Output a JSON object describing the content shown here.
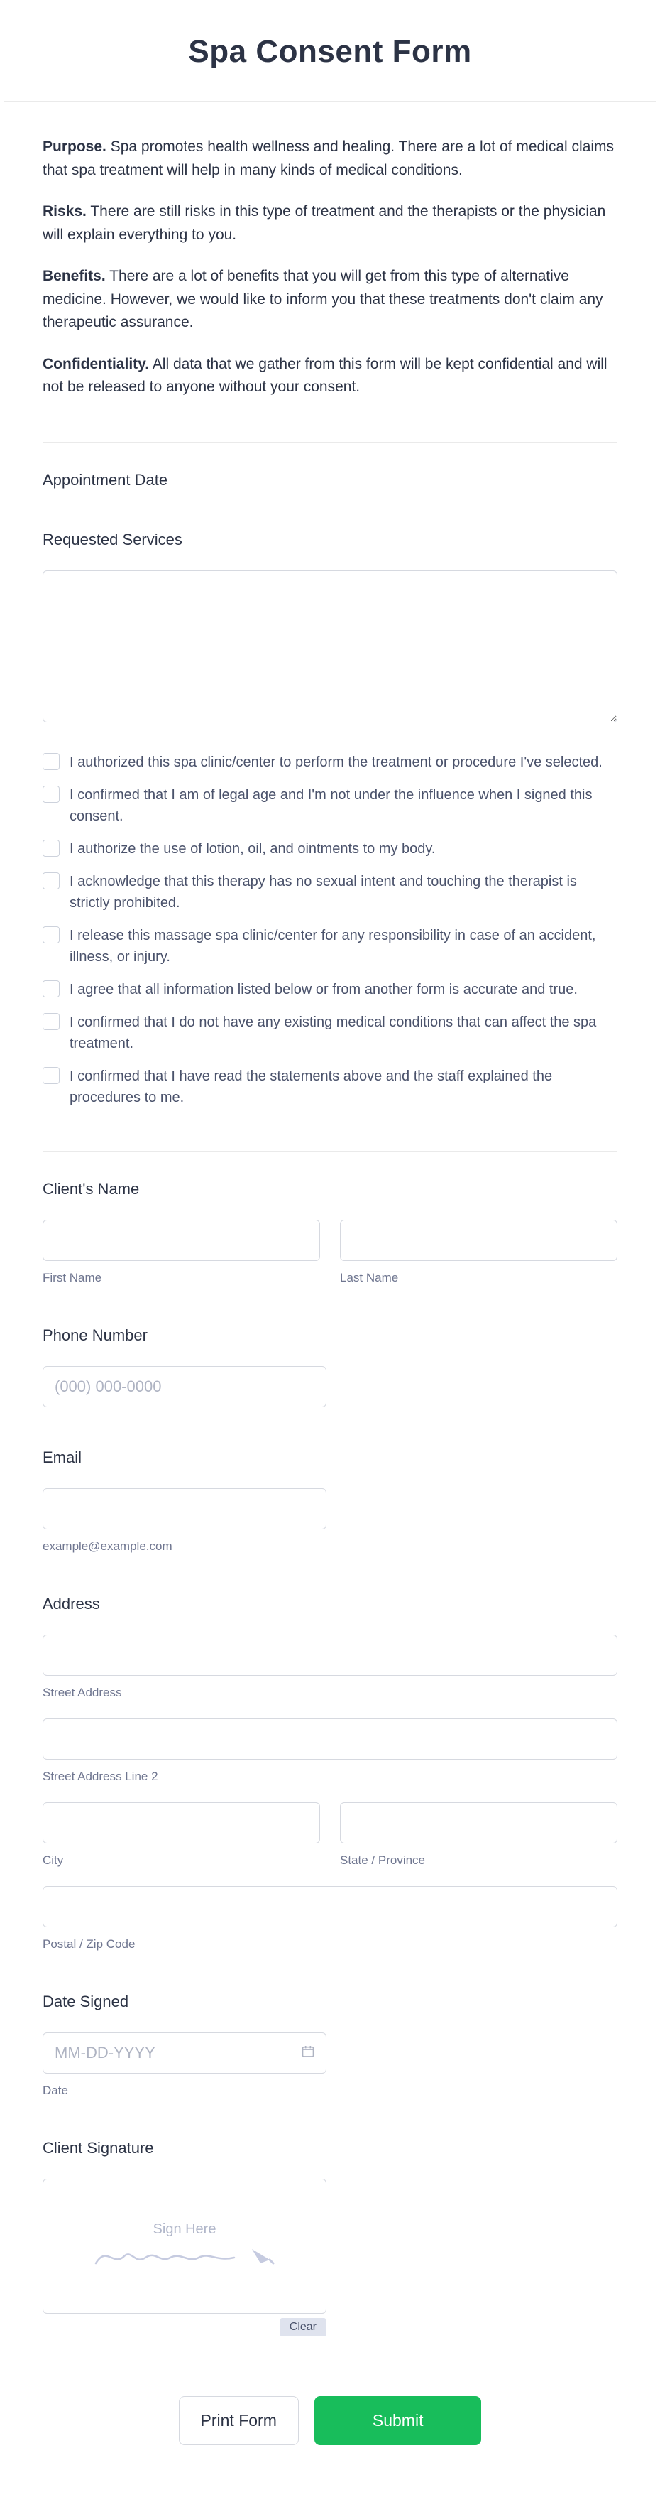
{
  "header": {
    "title": "Spa Consent Form"
  },
  "intro": {
    "purpose_label": "Purpose.",
    "purpose_text": " Spa promotes health wellness and healing. There are a lot of medical claims that spa treatment will help in many kinds of medical conditions.",
    "risks_label": "Risks.",
    "risks_text": " There are still risks in this type of treatment and the therapists or the physician will explain everything to you.",
    "benefits_label": "Benefits.",
    "benefits_text": " There are a lot of benefits that you will get from this type of alternative medicine. However, we would like to inform you that these treatments don't claim any therapeutic assurance.",
    "conf_label": "Confidentiality.",
    "conf_text": " All data that we gather from this form will be kept confidential and will not be released to anyone without your consent."
  },
  "labels": {
    "appointment_date": "Appointment Date",
    "requested_services": "Requested Services",
    "clients_name": "Client's Name",
    "first_name": "First Name",
    "last_name": "Last Name",
    "phone_number": "Phone Number",
    "phone_placeholder": "(000) 000-0000",
    "email": "Email",
    "email_hint": "example@example.com",
    "address": "Address",
    "street1": "Street Address",
    "street2": "Street Address Line 2",
    "city": "City",
    "state": "State / Province",
    "postal": "Postal / Zip Code",
    "date_signed": "Date Signed",
    "date_placeholder": "MM-DD-YYYY",
    "date_hint": "Date",
    "client_signature": "Client Signature",
    "sign_here": "Sign Here",
    "clear": "Clear"
  },
  "consents": [
    "I authorized this spa clinic/center to perform the treatment or procedure I've selected.",
    "I confirmed that I am of legal age and I'm not under the influence when I signed this consent.",
    "I authorize the use of lotion, oil, and ointments to my body.",
    "I acknowledge that this therapy has no sexual intent and touching the therapist is strictly prohibited.",
    "I release this massage spa clinic/center for any responsibility in case of an accident, illness, or injury.",
    "I agree that all information listed below or from another form is accurate and true.",
    "I confirmed that I do not have any existing medical conditions that can affect the spa treatment.",
    "I confirmed that I have read the statements above and the staff explained the procedures to me."
  ],
  "buttons": {
    "print": "Print Form",
    "submit": "Submit"
  }
}
